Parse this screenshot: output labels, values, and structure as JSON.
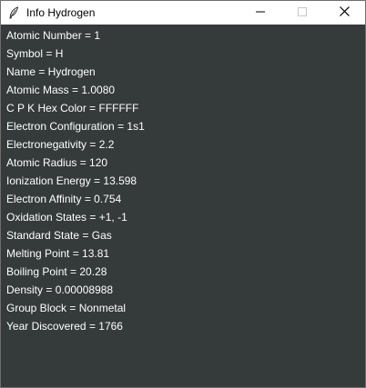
{
  "window": {
    "title": "Info Hydrogen",
    "icon": "feather-icon",
    "controls": [
      "minimize-icon",
      "maximize-icon",
      "close-icon"
    ],
    "colors": {
      "titlebar": "#ffffff",
      "content_background": "#353a3b",
      "text": "#ffffff"
    }
  },
  "info": {
    "rows": [
      "Atomic Number = 1",
      "Symbol = H",
      "Name = Hydrogen",
      "Atomic Mass = 1.0080",
      "C P K Hex Color = FFFFFF",
      "Electron Configuration = 1s1",
      "Electronegativity = 2.2",
      "Atomic Radius = 120",
      "Ionization Energy = 13.598",
      "Electron Affinity = 0.754",
      "Oxidation States = +1, -1",
      "Standard State = Gas",
      "Melting Point = 13.81",
      "Boiling Point = 20.28",
      "Density = 0.00008988",
      "Group Block = Nonmetal",
      "Year Discovered = 1766"
    ]
  }
}
